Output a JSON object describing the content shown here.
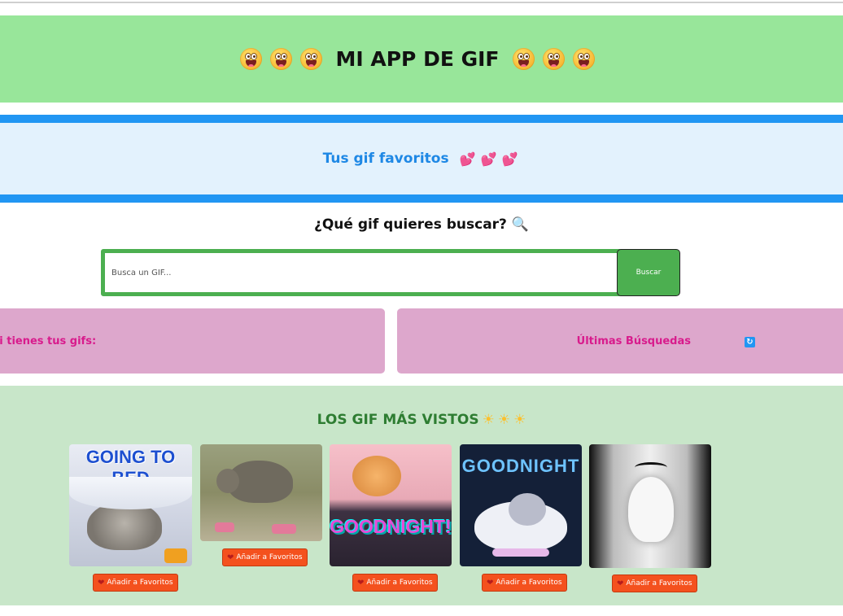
{
  "header": {
    "title": "MI APP DE GIF"
  },
  "favorites": {
    "label": "Tus gif favoritos",
    "hearts": [
      "💕",
      "💕",
      "💕"
    ]
  },
  "search": {
    "question": "¿Qué gif quieres buscar? 🔍",
    "placeholder": "Busca un GIF...",
    "button": "Buscar"
  },
  "panels": {
    "left": "ui tienes tus gifs:",
    "right": "Últimas Búsquedas",
    "right_icon": "refresh-icon"
  },
  "popular": {
    "title": "LOS GIF MÁS VISTOS",
    "suns": [
      "☀",
      "☀",
      "☀"
    ],
    "gifs": [
      {
        "caption": "GOING TO BED",
        "button": "Añadir a Favoritos"
      },
      {
        "caption": "",
        "button": "Añadir a Favoritos"
      },
      {
        "caption": "GOODNIGHT!",
        "button": "Añadir a Favoritos"
      },
      {
        "caption": "GOODNIGHT",
        "button": "Añadir a Favoritos"
      },
      {
        "caption": "",
        "button": "Añadir a Favoritos"
      }
    ]
  },
  "colors": {
    "header_bg": "#98e69a",
    "favorites_border": "#2196f3",
    "favorites_bg": "#e3f2fd",
    "search_green": "#4caf50",
    "panel_pink": "#dda7cc",
    "popular_bg": "#c8e6c9",
    "fav_button": "#f4511e"
  }
}
